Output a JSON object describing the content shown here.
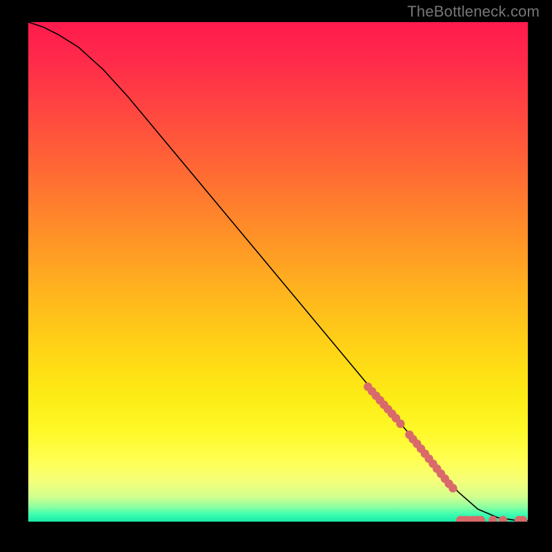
{
  "attribution": "TheBottleneck.com",
  "chart_data": {
    "type": "line",
    "title": "",
    "xlabel": "",
    "ylabel": "",
    "xlim": [
      0,
      100
    ],
    "ylim": [
      0,
      100
    ],
    "series": [
      {
        "name": "curve",
        "x": [
          0,
          3,
          6,
          10,
          15,
          20,
          30,
          40,
          50,
          60,
          70,
          78,
          82,
          86,
          90,
          94,
          98,
          100
        ],
        "y": [
          100,
          99,
          97.5,
          95,
          90.5,
          85,
          73,
          61,
          49,
          37,
          25,
          15.5,
          10.5,
          6,
          2.5,
          0.8,
          0.2,
          0.2
        ]
      }
    ],
    "scatter": {
      "name": "highlighted-points",
      "color": "#d96a6a",
      "points": [
        {
          "x": 68.0,
          "y": 27.0
        },
        {
          "x": 68.8,
          "y": 26.1
        },
        {
          "x": 69.6,
          "y": 25.2
        },
        {
          "x": 70.4,
          "y": 24.3
        },
        {
          "x": 71.2,
          "y": 23.4
        },
        {
          "x": 72.0,
          "y": 22.5
        },
        {
          "x": 72.8,
          "y": 21.6
        },
        {
          "x": 73.6,
          "y": 20.7
        },
        {
          "x": 74.5,
          "y": 19.6
        },
        {
          "x": 76.3,
          "y": 17.4
        },
        {
          "x": 77.0,
          "y": 16.5
        },
        {
          "x": 77.8,
          "y": 15.6
        },
        {
          "x": 78.6,
          "y": 14.6
        },
        {
          "x": 79.4,
          "y": 13.6
        },
        {
          "x": 80.2,
          "y": 12.6
        },
        {
          "x": 81.0,
          "y": 11.6
        },
        {
          "x": 81.8,
          "y": 10.6
        },
        {
          "x": 82.6,
          "y": 9.6
        },
        {
          "x": 83.4,
          "y": 8.6
        },
        {
          "x": 84.2,
          "y": 7.6
        },
        {
          "x": 85.0,
          "y": 6.7
        },
        {
          "x": 86.5,
          "y": 0.3
        },
        {
          "x": 87.3,
          "y": 0.3
        },
        {
          "x": 88.1,
          "y": 0.3
        },
        {
          "x": 89.0,
          "y": 0.3
        },
        {
          "x": 89.8,
          "y": 0.3
        },
        {
          "x": 90.6,
          "y": 0.3
        },
        {
          "x": 93.0,
          "y": 0.3
        },
        {
          "x": 95.0,
          "y": 0.3
        },
        {
          "x": 98.2,
          "y": 0.3
        },
        {
          "x": 99.0,
          "y": 0.3
        }
      ]
    }
  }
}
